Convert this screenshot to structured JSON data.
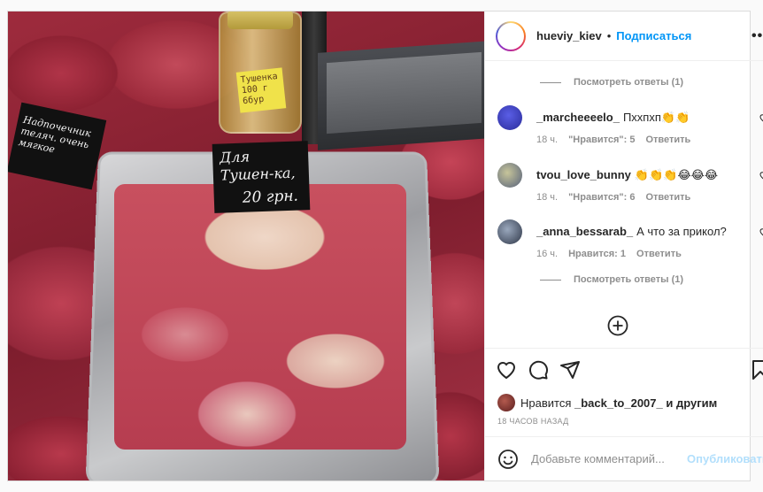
{
  "photo": {
    "main_sign": "Для Тушен-ка,",
    "main_sign_price": "20 грн.",
    "side_sign": "Надпочечник теляч. очень мягкое",
    "jar_label": "Тушенка 100 г 6бур"
  },
  "header": {
    "username": "hueviy_kiev",
    "dot": "•",
    "follow_label": "Подписаться",
    "more_icon": "more-horizontal-icon"
  },
  "comments": {
    "view_replies_top": "Посмотреть ответы (1)",
    "view_replies_bottom": "Посмотреть ответы (1)",
    "items": [
      {
        "username": "_marcheeeelo_",
        "text": "Пххпхп👏👏",
        "time": "18 ч.",
        "likes": "\"Нравится\": 5",
        "reply": "Ответить",
        "avatar_color": "#3b3fc4"
      },
      {
        "username": "tvou_love_bunny",
        "text": "👏👏👏😂😂😂",
        "time": "18 ч.",
        "likes": "\"Нравится\": 6",
        "reply": "Ответить",
        "avatar_color": "#8a8f6a"
      },
      {
        "username": "_anna_bessarab_",
        "text": "А что за прикол?",
        "time": "16 ч.",
        "likes": "Нравится: 1",
        "reply": "Ответить",
        "avatar_color": "#4a5870"
      }
    ]
  },
  "actions": {
    "like_icon": "heart-icon",
    "comment_icon": "comment-icon",
    "share_icon": "send-icon",
    "save_icon": "bookmark-icon"
  },
  "likes": {
    "prefix": "Нравится",
    "user": "_back_to_2007_",
    "suffix": "и другим"
  },
  "timestamp": "18 ЧАСОВ НАЗАД",
  "add_comment": {
    "placeholder": "Добавьте комментарий...",
    "publish_label": "Опубликовать"
  },
  "colors": {
    "accent": "#0095f6",
    "publish_disabled": "#b2dffc",
    "muted": "#8e8e8e"
  }
}
